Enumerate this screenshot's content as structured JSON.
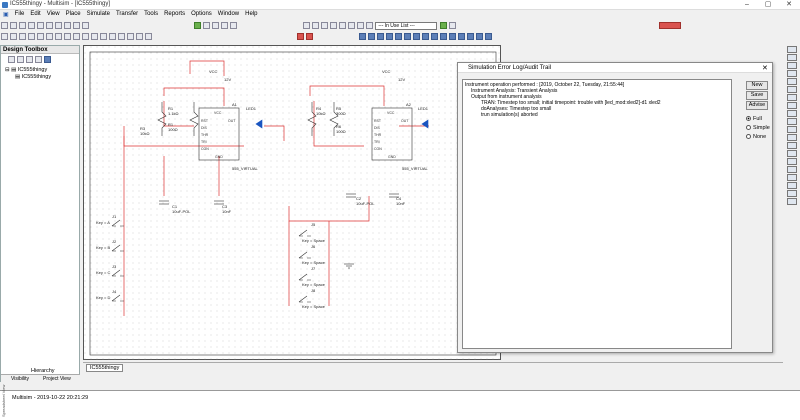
{
  "window": {
    "title": "IC555thingy - Multisim - [IC555thingy]",
    "minimize": "–",
    "maximize": "▢",
    "close": "✕"
  },
  "menu": [
    "File",
    "Edit",
    "View",
    "Place",
    "Simulate",
    "Transfer",
    "Tools",
    "Reports",
    "Options",
    "Window",
    "Help"
  ],
  "toolbar": {
    "inuse_list": "--- In Use List ---"
  },
  "design_toolbox": {
    "title": "Design Toolbox",
    "tree_root": "IC555thingy",
    "tree_child": "IC555thingy",
    "tabs": [
      "Visibility",
      "Project View"
    ],
    "hierarchy": "Hierarchy"
  },
  "schematic": {
    "tab": "IC555thingy",
    "left": {
      "vcc": "VCC",
      "v12": "12V",
      "a1": "A1",
      "chip": "555_VIRTUAL",
      "r1": "R1",
      "r1v": "1.1kΩ",
      "r3": "R3",
      "r3v": "10kΩ",
      "rx": "R1",
      "rxv": "100Ω",
      "led": "LED1",
      "c1": "C1",
      "c1v": "10uF-POL",
      "c3": "C3",
      "c3v": "10nF"
    },
    "right": {
      "vcc": "VCC",
      "v12": "12V",
      "a2": "A2",
      "chip": "555_VIRTUAL",
      "r4": "R4",
      "r4v": "10kΩ",
      "r5": "R5",
      "r5v": "300Ω",
      "r6": "R6",
      "r6v": "100Ω",
      "led": "LED1",
      "c2": "C2",
      "c2v": "10uF-POL",
      "c4": "C4",
      "c4v": "10nF"
    },
    "pins": [
      "VCC",
      "RST",
      "DIS",
      "THR",
      "TRI",
      "CON",
      "GND",
      "OUT"
    ],
    "keys_left": [
      "Key = A",
      "Key = B",
      "Key = C",
      "Key = D"
    ],
    "keys_right": [
      "Key = Space",
      "Key = Space",
      "Key = Space",
      "Key = Space"
    ],
    "switch_labels": [
      "J1",
      "J2",
      "J3",
      "J4",
      "J5",
      "J6",
      "J7",
      "J8"
    ]
  },
  "dialog": {
    "title": "Simulation Error Log/Audit Trail",
    "close": "✕",
    "log": [
      "Instrument operation performed : [2019, October 22, Tuesday, 21:55:44]",
      "Instrument Analysis: Transient Analysis",
      "Output from instrument analysis",
      "TRAN:  Timestep too small; initial timepoint: trouble with [led_mod:xled2]-d1 xled2",
      "doAnalyses: Timestep too small",
      "",
      "trun simulation(s) aborted"
    ],
    "buttons": [
      "New",
      "Save",
      "Advise"
    ],
    "radios": [
      "Full",
      "Simple",
      "None"
    ],
    "selected_radio": "Full"
  },
  "spreadsheet": {
    "line": "Multisim  -  2019-10-22 20:21:29",
    "side_label": "Spreadsheet View"
  }
}
